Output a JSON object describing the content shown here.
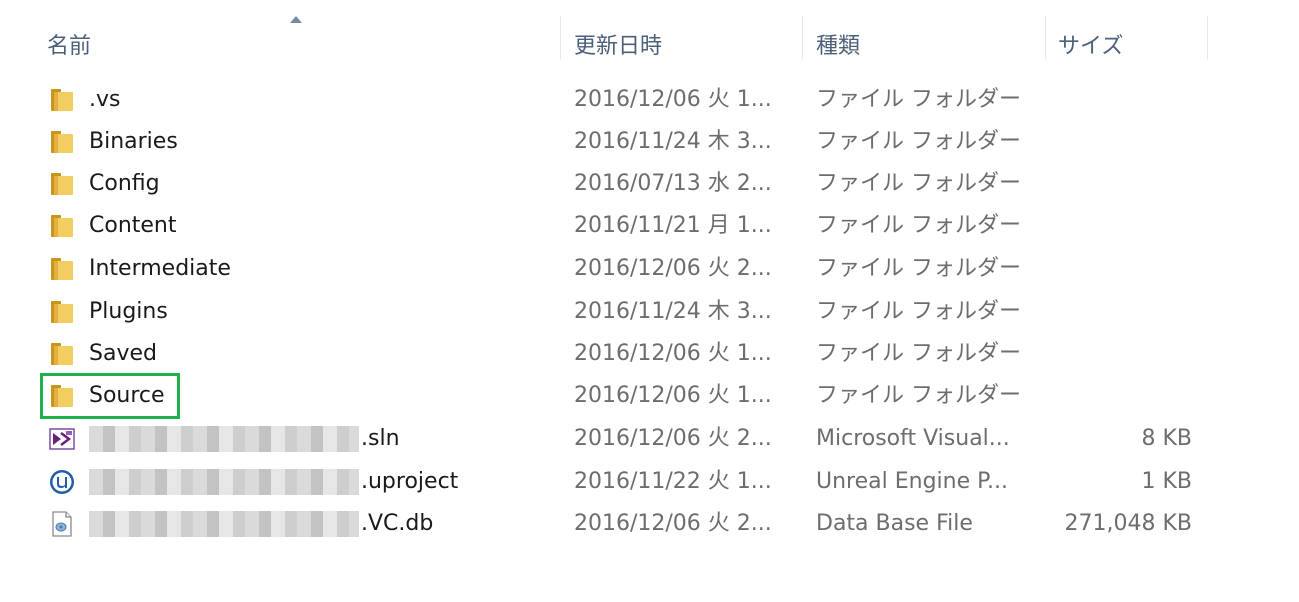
{
  "columns": {
    "name": "名前",
    "date": "更新日時",
    "type": "種類",
    "size": "サイズ"
  },
  "colors": {
    "folder": "#e8b94a",
    "highlight": "#1db34a",
    "header_text": "#4c607a"
  },
  "files": [
    {
      "name": ".vs",
      "date": "2016/12/06 火 1...",
      "type": "ファイル フォルダー",
      "size": "",
      "icon": "folder-icon"
    },
    {
      "name": "Binaries",
      "date": "2016/11/24 木 3...",
      "type": "ファイル フォルダー",
      "size": "",
      "icon": "folder-icon"
    },
    {
      "name": "Config",
      "date": "2016/07/13 水 2...",
      "type": "ファイル フォルダー",
      "size": "",
      "icon": "folder-icon"
    },
    {
      "name": "Content",
      "date": "2016/11/21 月 1...",
      "type": "ファイル フォルダー",
      "size": "",
      "icon": "folder-icon"
    },
    {
      "name": "Intermediate",
      "date": "2016/12/06 火 2...",
      "type": "ファイル フォルダー",
      "size": "",
      "icon": "folder-icon"
    },
    {
      "name": "Plugins",
      "date": "2016/11/24 木 3...",
      "type": "ファイル フォルダー",
      "size": "",
      "icon": "folder-icon"
    },
    {
      "name": "Saved",
      "date": "2016/12/06 火 1...",
      "type": "ファイル フォルダー",
      "size": "",
      "icon": "folder-icon"
    },
    {
      "name": "Source",
      "date": "2016/12/06 火 1...",
      "type": "ファイル フォルダー",
      "size": "",
      "icon": "folder-icon"
    },
    {
      "name": ".sln",
      "date": "2016/12/06 火 2...",
      "type": "Microsoft Visual...",
      "size": "8 KB",
      "icon": "visual-studio-solution-icon"
    },
    {
      "name": ".uproject",
      "date": "2016/11/22 火 1...",
      "type": "Unreal Engine P...",
      "size": "1 KB",
      "icon": "unreal-engine-icon"
    },
    {
      "name": ".VC.db",
      "date": "2016/12/06 火 2...",
      "type": "Data Base File",
      "size": "271,048 KB",
      "icon": "database-file-icon"
    }
  ]
}
